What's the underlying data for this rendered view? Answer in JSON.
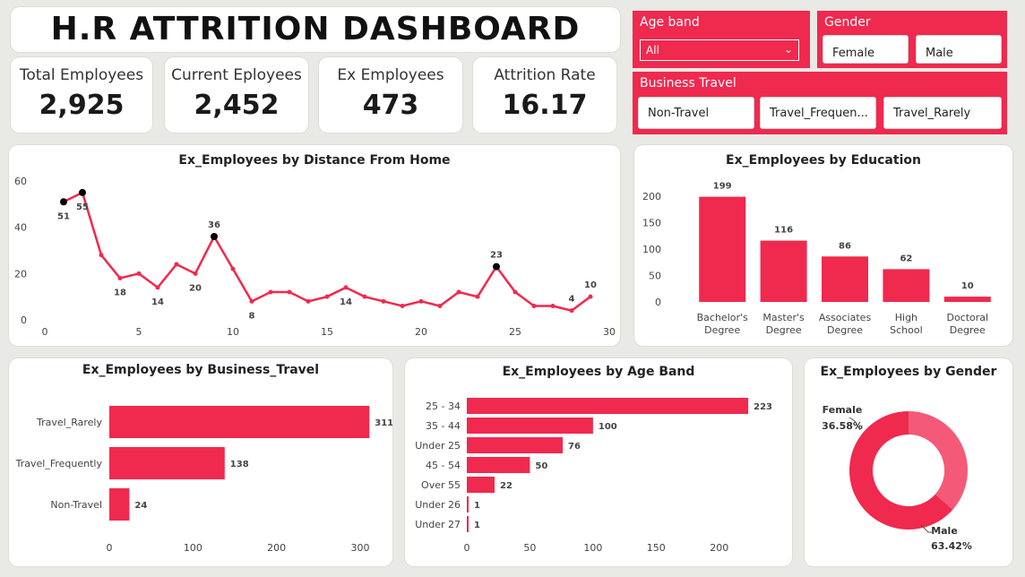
{
  "title": "H.R ATTRITION DASHBOARD",
  "kpis": [
    {
      "label": "Total Employees",
      "value": "2,925"
    },
    {
      "label": "Current Eployees",
      "value": "2,452"
    },
    {
      "label": "Ex Employees",
      "value": "473"
    },
    {
      "label": "Attrition Rate",
      "value": "16.17"
    }
  ],
  "slicers": {
    "age_band": {
      "title": "Age band",
      "selected": "All",
      "chevron": "⌄"
    },
    "gender": {
      "title": "Gender",
      "options": [
        "Female",
        "Male"
      ]
    },
    "business_travel": {
      "title": "Business Travel",
      "options": [
        "Non-Travel",
        "Travel_Frequen...",
        "Travel_Rarely"
      ]
    }
  },
  "colors": {
    "accent": "#f0294e",
    "accent_light": "#f45a77",
    "marker": "#000000"
  },
  "chart_data": [
    {
      "id": "distance",
      "type": "line",
      "title": "Ex_Employees by Distance From Home",
      "x": [
        1,
        2,
        3,
        4,
        5,
        6,
        7,
        8,
        9,
        10,
        11,
        12,
        13,
        14,
        15,
        16,
        17,
        18,
        19,
        20,
        21,
        22,
        23,
        24,
        25,
        26,
        27,
        28,
        29
      ],
      "values": [
        51,
        55,
        28,
        18,
        20,
        14,
        24,
        20,
        36,
        22,
        8,
        12,
        12,
        8,
        10,
        14,
        10,
        8,
        6,
        8,
        6,
        12,
        10,
        23,
        12,
        6,
        6,
        4,
        10
      ],
      "data_labels": [
        {
          "x": 1,
          "text": "51"
        },
        {
          "x": 2,
          "text": "55"
        },
        {
          "x": 4,
          "text": "18"
        },
        {
          "x": 6,
          "text": "14"
        },
        {
          "x": 8,
          "text": "20"
        },
        {
          "x": 9,
          "text": "36"
        },
        {
          "x": 11,
          "text": "8"
        },
        {
          "x": 16,
          "text": "14"
        },
        {
          "x": 24,
          "text": "23"
        },
        {
          "x": 28,
          "text": "4"
        },
        {
          "x": 29,
          "text": "10"
        }
      ],
      "markers_at": [
        1,
        2,
        9,
        24
      ],
      "xticks": [
        0,
        5,
        10,
        15,
        20,
        25,
        30
      ],
      "yticks": [
        0,
        20,
        40,
        60
      ],
      "xlim": [
        0,
        30
      ],
      "ylim": [
        0,
        60
      ]
    },
    {
      "id": "education",
      "type": "bar",
      "title": "Ex_Employees by Education",
      "categories": [
        "Bachelor's Degree",
        "Master's Degree",
        "Associates Degree",
        "High School",
        "Doctoral Degree"
      ],
      "category_lines": [
        [
          "Bachelor's",
          "Degree"
        ],
        [
          "Master's",
          "Degree"
        ],
        [
          "Associates",
          "Degree"
        ],
        [
          "High",
          "School"
        ],
        [
          "Doctoral",
          "Degree"
        ]
      ],
      "values": [
        199,
        116,
        86,
        62,
        10
      ],
      "yticks": [
        0,
        50,
        100,
        150,
        200
      ],
      "ylim": [
        0,
        200
      ]
    },
    {
      "id": "business_travel",
      "type": "bar",
      "orientation": "horizontal",
      "title": "Ex_Employees by Business_Travel",
      "categories": [
        "Travel_Rarely",
        "Travel_Frequently",
        "Non-Travel"
      ],
      "values": [
        311,
        138,
        24
      ],
      "xticks": [
        0,
        100,
        200,
        300
      ],
      "xlim": [
        0,
        330
      ]
    },
    {
      "id": "age_band",
      "type": "bar",
      "orientation": "horizontal",
      "title": "Ex_Employees by Age Band",
      "categories": [
        "25 - 34",
        "35 - 44",
        "Under 25",
        "45 - 54",
        "Over 55",
        "Under 26",
        "Under 27"
      ],
      "values": [
        223,
        100,
        76,
        50,
        22,
        1,
        1
      ],
      "xticks": [
        0,
        50,
        100,
        150,
        200
      ],
      "xlim": [
        0,
        230
      ]
    },
    {
      "id": "gender",
      "type": "pie",
      "donut": true,
      "title": "Ex_Employees by Gender",
      "slices": [
        {
          "name": "Female",
          "label": "Female",
          "pct_text": "36.58%",
          "value": 36.58,
          "color": "#f45a77"
        },
        {
          "name": "Male",
          "label": "Male",
          "pct_text": "63.42%",
          "value": 63.42,
          "color": "#f0294e"
        }
      ]
    }
  ]
}
